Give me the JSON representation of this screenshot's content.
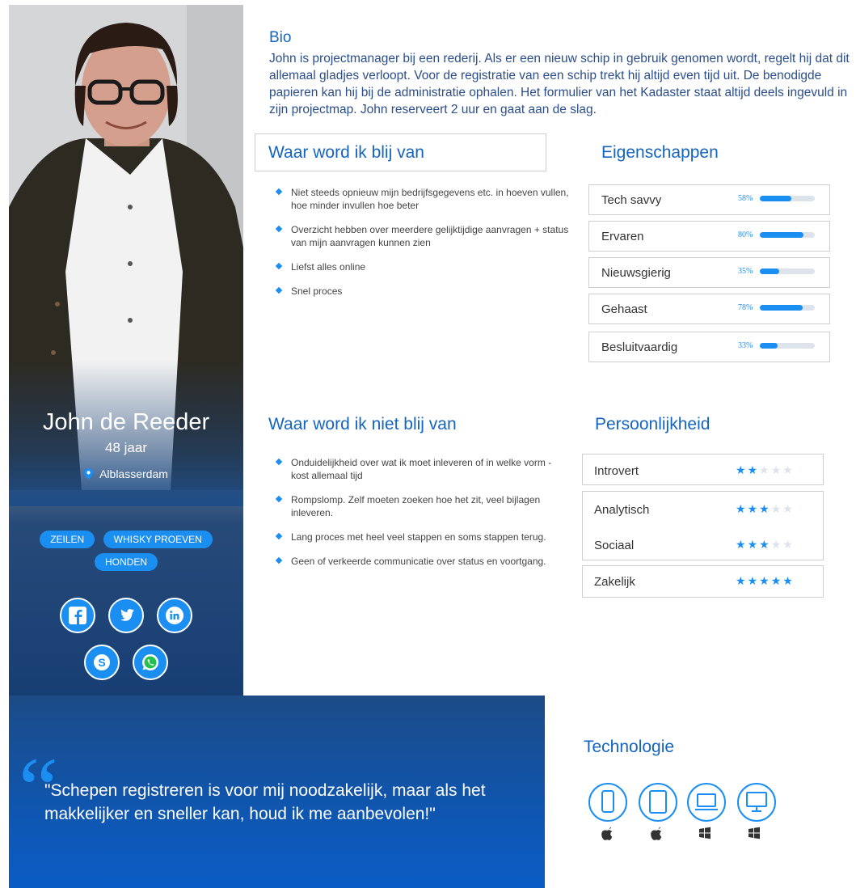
{
  "profile": {
    "name": "John de Reeder",
    "age": "48 jaar",
    "location": "Alblasserdam",
    "tags": [
      "ZEILEN",
      "WHISKY PROEVEN",
      "HONDEN"
    ],
    "socials": [
      "facebook-icon",
      "twitter-icon",
      "linkedin-icon",
      "skype-icon",
      "whatsapp-icon"
    ]
  },
  "bio": {
    "title": "Bio",
    "text": "John is projectmanager bij een rederij. Als er een nieuw schip in gebruik genomen wordt, regelt hij dat dit allemaal gladjes verloopt. Voor de registratie van een schip trekt hij altijd even tijd uit. De benodigde papieren kan hij bij de administratie ophalen. Het formulier van het Kadaster staat altijd deels ingevuld in zijn projectmap. John reserveert 2 uur en gaat aan de slag."
  },
  "likes": {
    "title": "Waar word ik blij van",
    "items": [
      "Niet steeds opnieuw mijn bedrijfsgegevens etc. in hoeven vullen, hoe minder invullen hoe beter",
      "Overzicht hebben over meerdere gelijktijdige aanvragen + status van mijn aanvragen kunnen zien",
      "Liefst alles online",
      "Snel proces"
    ]
  },
  "dislikes": {
    "title": "Waar word ik niet blij van",
    "items": [
      "Onduidelijkheid over wat ik moet inleveren of in welke vorm - kost allemaal tijd",
      "Rompslomp. Zelf moeten zoeken hoe het zit, veel bijlagen inleveren.",
      "Lang proces met heel veel stappen en soms stappen terug.",
      "Geen of verkeerde communicatie over status en voortgang."
    ]
  },
  "traits": {
    "title": "Eigenschappen",
    "items": [
      {
        "label": "Tech savvy",
        "pct_text": "58%",
        "value": 58
      },
      {
        "label": "Ervaren",
        "pct_text": "80%",
        "value": 80
      },
      {
        "label": "Nieuwsgierig",
        "pct_text": "35%",
        "value": 35
      },
      {
        "label": "Gehaast",
        "pct_text": "78%",
        "value": 78
      },
      {
        "label": "Besluitvaardig",
        "pct_text": "33%",
        "value": 33
      }
    ]
  },
  "personality": {
    "title": "Persoonlijkheid",
    "items": [
      {
        "label": "Introvert",
        "stars": 2
      },
      {
        "label": "Analytisch",
        "stars": 3
      },
      {
        "label": "Sociaal",
        "stars": 3
      },
      {
        "label": "Zakelijk",
        "stars": 5
      }
    ],
    "max_stars": 5
  },
  "quote": {
    "text": "\"Schepen registreren is voor mij noodzakelijk, maar als het makkelijker en sneller kan, houd ik me aanbevolen!\""
  },
  "technology": {
    "title": "Technologie",
    "devices": [
      {
        "device": "smartphone-icon",
        "os": "apple-icon"
      },
      {
        "device": "tablet-icon",
        "os": "apple-icon"
      },
      {
        "device": "laptop-icon",
        "os": "windows-icon"
      },
      {
        "device": "desktop-icon",
        "os": "windows-icon"
      }
    ]
  },
  "colors": {
    "accent": "#1b8ef2",
    "title_blue": "#1565c0",
    "quote_bg": "#0f56b0"
  }
}
